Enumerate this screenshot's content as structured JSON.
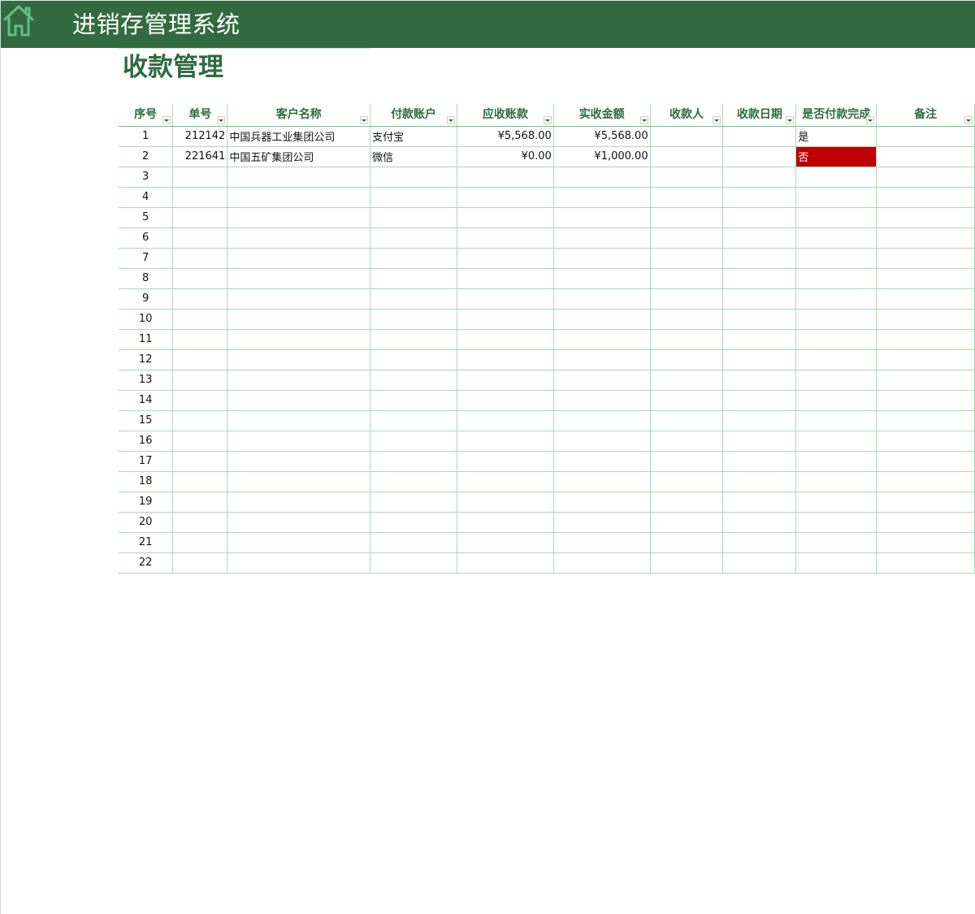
{
  "header": {
    "app_title": "进销存管理系统",
    "page_title": "收款管理",
    "home_icon": "home-icon"
  },
  "colors": {
    "header_bg": "#326b40",
    "accent_green": "#2f6b3e",
    "grid_line": "#a9dab5",
    "status_no_bg": "#c00000"
  },
  "table": {
    "columns": [
      {
        "key": "seq",
        "label": "序号",
        "filter": true
      },
      {
        "key": "order_no",
        "label": "单号",
        "filter": true
      },
      {
        "key": "customer",
        "label": "客户名称",
        "filter": true
      },
      {
        "key": "account",
        "label": "付款账户",
        "filter": true
      },
      {
        "key": "receivable",
        "label": "应收账款",
        "filter": true
      },
      {
        "key": "received",
        "label": "实收金额",
        "filter": true
      },
      {
        "key": "receiver",
        "label": "收款人",
        "filter": true
      },
      {
        "key": "date",
        "label": "收款日期",
        "filter": true
      },
      {
        "key": "done",
        "label": "是否付款完成",
        "filter": true
      },
      {
        "key": "remark",
        "label": "备注",
        "filter": true
      }
    ],
    "rows": [
      {
        "seq": "1",
        "order_no": "212142",
        "customer": "中国兵器工业集团公司",
        "account": "支付宝",
        "receivable": "¥5,568.00",
        "received": "¥5,568.00",
        "receiver": "",
        "date": "",
        "done": "是",
        "remark": ""
      },
      {
        "seq": "2",
        "order_no": "221641",
        "customer": "中国五矿集团公司",
        "account": "微信",
        "receivable": "¥0.00",
        "received": "¥1,000.00",
        "receiver": "",
        "date": "",
        "done": "否",
        "remark": ""
      },
      {
        "seq": "3"
      },
      {
        "seq": "4"
      },
      {
        "seq": "5"
      },
      {
        "seq": "6"
      },
      {
        "seq": "7"
      },
      {
        "seq": "8"
      },
      {
        "seq": "9"
      },
      {
        "seq": "10"
      },
      {
        "seq": "11"
      },
      {
        "seq": "12"
      },
      {
        "seq": "13"
      },
      {
        "seq": "14"
      },
      {
        "seq": "15"
      },
      {
        "seq": "16"
      },
      {
        "seq": "17"
      },
      {
        "seq": "18"
      },
      {
        "seq": "19"
      },
      {
        "seq": "20"
      },
      {
        "seq": "21"
      },
      {
        "seq": "22"
      }
    ]
  }
}
